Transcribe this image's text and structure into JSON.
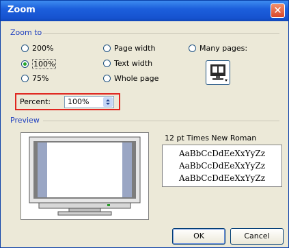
{
  "window": {
    "title": "Zoom",
    "close_glyph": "✕"
  },
  "zoom_to": {
    "label": "Zoom to",
    "options": [
      {
        "label": "200%",
        "selected": false
      },
      {
        "label": "100%",
        "selected": true
      },
      {
        "label": "75%",
        "selected": false
      },
      {
        "label": "Page width",
        "selected": false
      },
      {
        "label": "Text width",
        "selected": false
      },
      {
        "label": "Whole page",
        "selected": false
      },
      {
        "label": "Many pages:",
        "selected": false
      }
    ],
    "many_pages_icon": "monitor-pages-icon"
  },
  "percent": {
    "label": "Percent:",
    "value": "100%"
  },
  "preview": {
    "label": "Preview",
    "font_sample_title": "12 pt Times New Roman",
    "sample_lines": [
      "AaBbCcDdEeXxYyZz",
      "AaBbCcDdEeXxYyZz",
      "AaBbCcDdEeXxYyZz"
    ]
  },
  "buttons": {
    "ok": "OK",
    "cancel": "Cancel"
  },
  "colors": {
    "titlebar": "#1c5fdc",
    "highlight": "#e0261f",
    "group_label": "#1f3fbf"
  }
}
